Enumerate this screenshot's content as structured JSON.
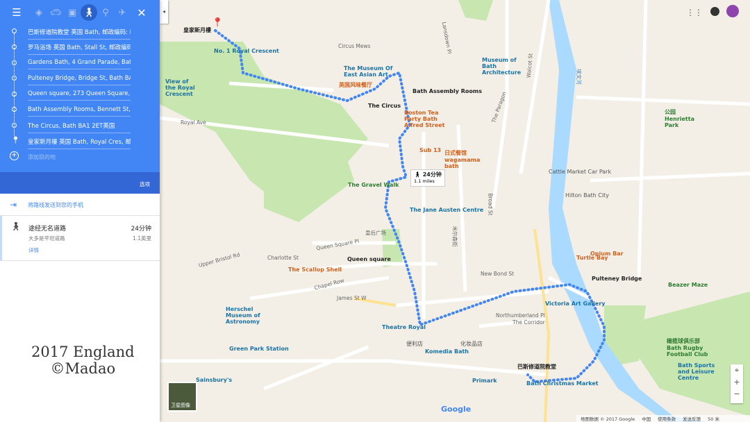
{
  "modes": {
    "menu": "menu-icon",
    "items": [
      "best-route-icon",
      "car-icon",
      "transit-icon",
      "walk-icon",
      "bicycle-icon",
      "flight-icon"
    ],
    "active": "walk-icon",
    "close": "close-icon"
  },
  "waypoints": [
    "巴斯修道院教堂 英国 Bath, 邮政编码: BA",
    "罗马浴场 英国 Bath, Stall St, 邮政编码: B",
    "Gardens Bath, 4 Grand Parade, Bath BA",
    "Pulteney Bridge, Bridge St, Bath BA2 4A",
    "Queen square, 273 Queen Square, Bath",
    "Bath Assembly Rooms, Bennett St, Bath",
    "The Circus, Bath BA1 2ET英国",
    "皇家新月樓 英国 Bath, Royal Cres, 邮政"
  ],
  "add_destination": "添加目的地",
  "options_label": "选项",
  "send_to_phone": "将路线发送到您的手机",
  "route": {
    "title": "途经无名道路",
    "subtitle": "大多是平坦道路",
    "time": "24分钟",
    "distance": "1.1英里",
    "details": "详情"
  },
  "map": {
    "time_bubble": {
      "time": "24分钟",
      "distance": "1.1 miles"
    },
    "markers": {
      "crescent": "皇家新月樓",
      "circus": "The Circus",
      "assembly": "Bath Assembly Rooms",
      "queen": "Queen square",
      "pulteney": "Pulteney Bridge",
      "abbey": "巴斯修道院教堂"
    },
    "pois": [
      "No. 1 Royal Crescent",
      "View of the Royal Crescent",
      "The Museum Of East Asian Art",
      "英国风味餐厅",
      "Museum of Bath Architecture",
      "Boston Tea Party Bath Alfred Street",
      "Sub 13",
      "日式餐馆 wagamama bath",
      "The Gravel Walk",
      "The Jane Austen Centre",
      "Cattle Market Car Park",
      "Hilton Bath City",
      "公园 Henrietta Park",
      "The Scallop Shell",
      "Herschel Museum of Astronomy",
      "Green Park Station",
      "Theatre Royal",
      "Komedia Bath",
      "Victoria Art Gallery",
      "Beazer Maze",
      "Turtle Bay",
      "Opium Bar",
      "Bath Christmas Market",
      "Primark",
      "Bath Sports and Leisure Centre",
      "橄榄球俱乐部 Bath Rugby Football Club",
      "化妆品店",
      "便利店",
      "Sainsbury's"
    ],
    "roads": [
      "Royal Ave",
      "Circus Mews",
      "Lansdown Pl",
      "The Paragon",
      "Walcot St",
      "埃文河",
      "Queen Square Pl",
      "Charlotte St",
      "Chapel Row",
      "James St W",
      "New Bond St",
      "Northumberland Pl",
      "The Corridor",
      "Upper Bristol Rd",
      "Broad St",
      "皇后广场",
      "米尔森街"
    ],
    "satellite_label": "卫星图像",
    "footer": [
      "地图数据 © 2017 Google",
      "中国",
      "使用条款",
      "发送反馈",
      "50 米"
    ],
    "google_logo": "Google"
  },
  "watermark": {
    "line1": "2017 England",
    "line2": "©Madao"
  },
  "colors": {
    "accent": "#4285f4",
    "route": "#4285f4",
    "park": "#c8e6b0",
    "water": "#aadaff"
  }
}
